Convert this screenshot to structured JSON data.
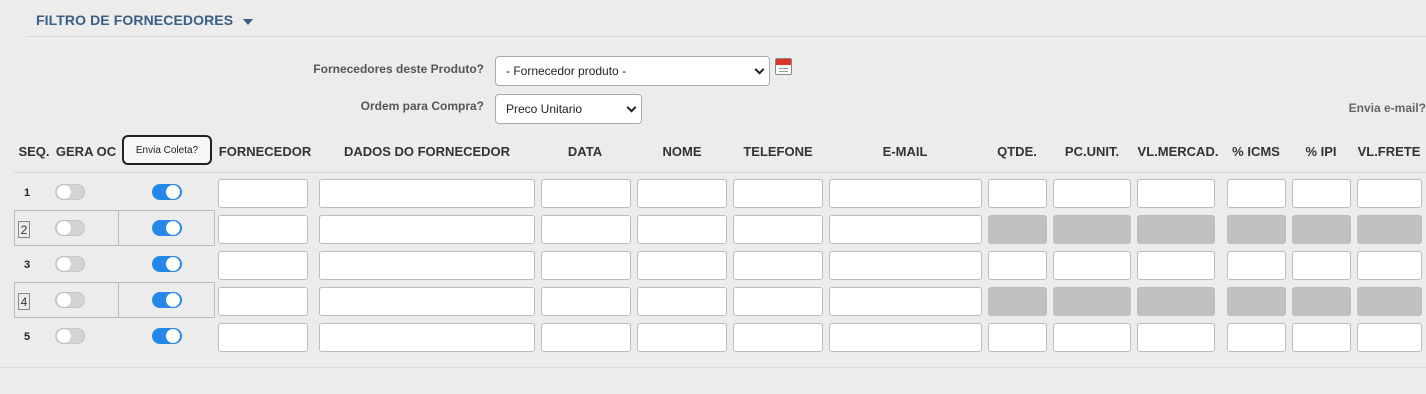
{
  "section": {
    "title": "FILTRO DE FORNECEDORES",
    "toggle_icon": "caret-down-icon"
  },
  "filters": {
    "fornecedores_label": "Fornecedores deste Produto?",
    "fornecedores_value": "- Fornecedor produto -",
    "ordem_label": "Ordem para Compra?",
    "ordem_value": "Preco Unitario",
    "calendar_icon": "calendar-icon"
  },
  "envia_email_label": "Envia e-mail?",
  "columns": {
    "seq": "SEQ.",
    "gera_oc": "GERA OC",
    "envia_coleta": "Envia Coleta?",
    "fornecedor": "FORNECEDOR",
    "dados": "DADOS DO FORNECEDOR",
    "data": "DATA",
    "nome": "NOME",
    "telefone": "TELEFONE",
    "email": "E-MAIL",
    "qtde": "QTDE.",
    "pc_unit": "PC.UNIT.",
    "vl_mercad": "VL.MERCAD.",
    "icms": "% ICMS",
    "ipi": "% IPI",
    "vl_frete": "VL.FRETE"
  },
  "rows": [
    {
      "seq": "1",
      "gera_oc": false,
      "envia_coleta": true,
      "values_disabled": false
    },
    {
      "seq": "2",
      "gera_oc": false,
      "envia_coleta": true,
      "values_disabled": true
    },
    {
      "seq": "3",
      "gera_oc": false,
      "envia_coleta": true,
      "values_disabled": false
    },
    {
      "seq": "4",
      "gera_oc": false,
      "envia_coleta": true,
      "values_disabled": true
    },
    {
      "seq": "5",
      "gera_oc": false,
      "envia_coleta": true,
      "values_disabled": false
    }
  ],
  "colors": {
    "title": "#3a5f86",
    "toggle_on": "#2588e8",
    "toggle_off": "#d4d4d4",
    "disabled_cell": "#c1c1c1"
  }
}
